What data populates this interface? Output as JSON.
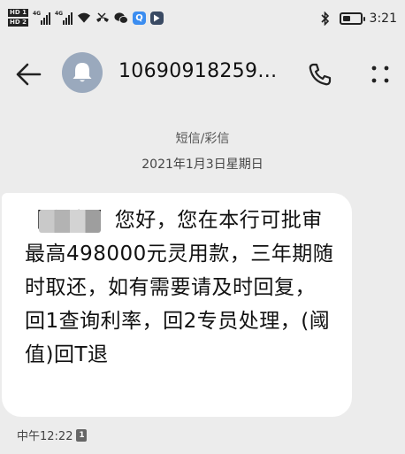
{
  "status_bar": {
    "hd1": "HD 1",
    "hd2": "HD 2",
    "net1": "4G",
    "net2": "4G",
    "app_q": "Q",
    "time": "3:21",
    "icons": [
      "wifi-icon",
      "missed-call-icon",
      "wechat-icon",
      "q-app-icon",
      "play-app-icon",
      "bluetooth-icon",
      "battery-icon"
    ]
  },
  "header": {
    "contact": "10690918259…",
    "icons": [
      "back-arrow-icon",
      "bell-avatar-icon",
      "phone-icon",
      "more-dots-icon"
    ]
  },
  "conversation": {
    "message_type": "短信/彩信",
    "date": "2021年1月3日星期日",
    "message": {
      "text": "【      银行】您好，您在本行可批审最高498000元灵用款，三年期随时取还，如有需要请及时回复，回1查询利率，回2专员处理，(阈值)回T退",
      "time": "中午12:22",
      "sim": "1"
    }
  },
  "colors": {
    "background": "#ececec",
    "bubble": "#ffffff",
    "avatar": "#9aa9bd",
    "text": "#111111"
  }
}
